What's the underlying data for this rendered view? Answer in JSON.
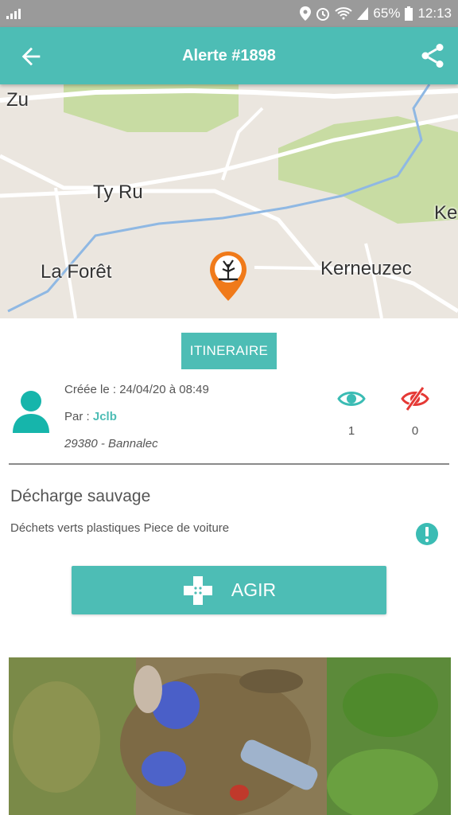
{
  "status_bar": {
    "battery": "65%",
    "time": "12:13"
  },
  "app_bar": {
    "title": "Alerte #1898"
  },
  "map": {
    "places": [
      "Zu",
      "Ty Ru",
      "Ke",
      "La Forêt",
      "Kerneuzec"
    ],
    "pin_icon": "pollution-marker-icon"
  },
  "alert": {
    "itinerary_label": "ITINERAIRE",
    "created": "Créée le : 24/04/20 à 08:49",
    "author_prefix": "Par : ",
    "author": "Jclb",
    "location": "29380 - Bannalec",
    "views": "1",
    "hides": "0",
    "category": "Décharge sauvage",
    "description": "Déchets verts plastiques Piece de voiture",
    "action_label": "AGIR"
  },
  "colors": {
    "accent": "#4dbdb5",
    "danger": "#e53935",
    "pin": "#f07a1a"
  }
}
